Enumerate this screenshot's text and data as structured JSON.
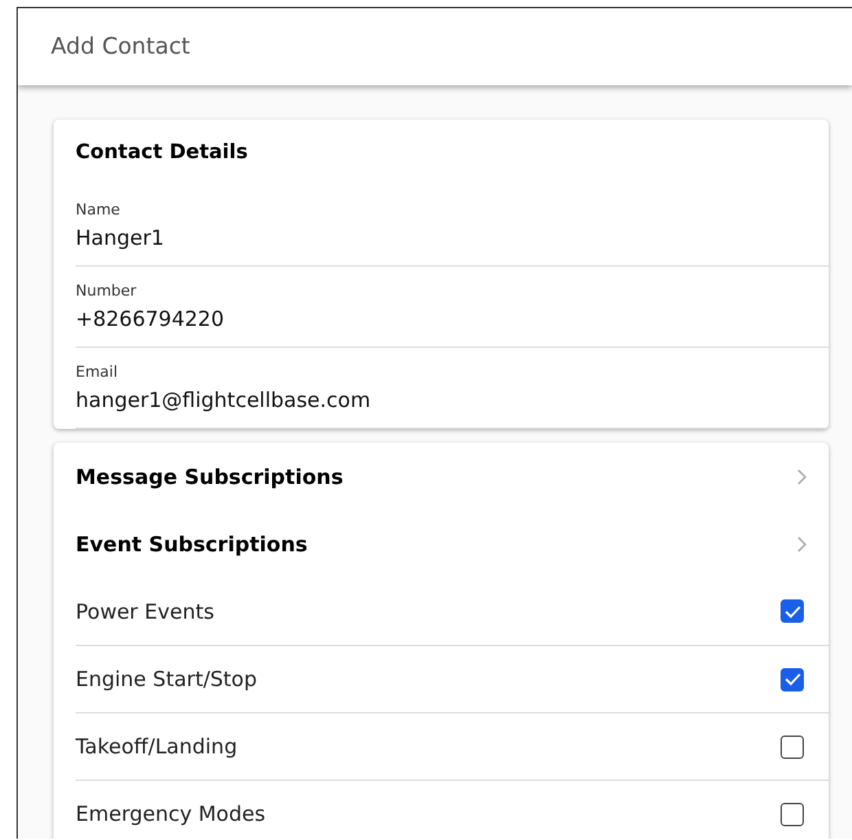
{
  "header": {
    "title": "Add Contact"
  },
  "contact_details": {
    "title": "Contact Details",
    "fields": [
      {
        "label": "Name",
        "value": "Hanger1"
      },
      {
        "label": "Number",
        "value": "+8266794220"
      },
      {
        "label": "Email",
        "value": "hanger1@flightcellbase.com"
      }
    ]
  },
  "subscriptions": [
    {
      "kind": "nav",
      "label": "Message Subscriptions"
    },
    {
      "kind": "nav",
      "label": "Event Subscriptions"
    },
    {
      "kind": "checkbox",
      "label": "Power Events",
      "checked": true
    },
    {
      "kind": "checkbox",
      "label": "Engine Start/Stop",
      "checked": true
    },
    {
      "kind": "checkbox",
      "label": "Takeoff/Landing",
      "checked": false
    },
    {
      "kind": "checkbox",
      "label": "Emergency Modes",
      "checked": false
    }
  ]
}
